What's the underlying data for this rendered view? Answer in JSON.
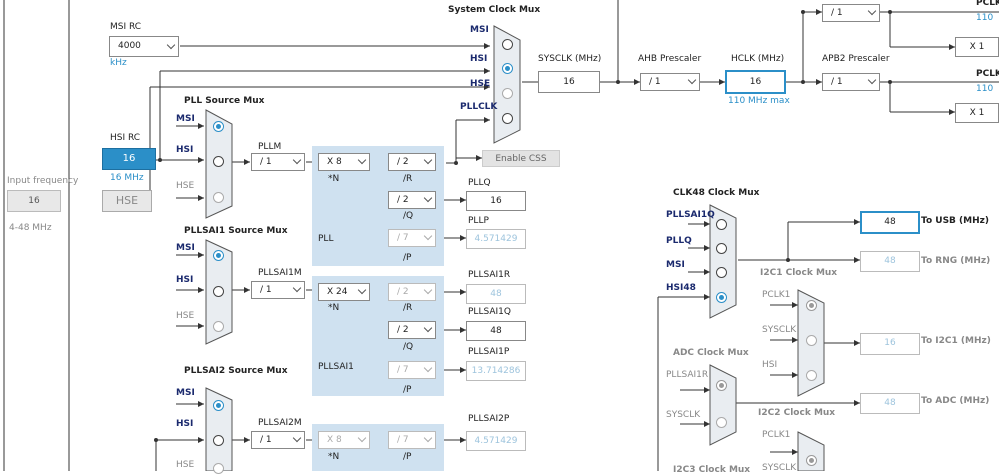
{
  "input_freq": {
    "label": "Input frequency",
    "value": "16",
    "range": "4-48 MHz"
  },
  "msi_rc": {
    "label": "MSI RC",
    "value": "4000",
    "unit": "kHz"
  },
  "hsi_rc": {
    "label": "HSI RC",
    "value": "16",
    "unit": "16 MHz"
  },
  "hse": {
    "label": "HSE"
  },
  "pll_source_mux": {
    "title": "PLL Source Mux",
    "inputs": [
      "MSI",
      "HSI",
      "HSE"
    ]
  },
  "pllm": {
    "label": "PLLM",
    "value": "/ 1"
  },
  "pll": {
    "label": "PLL",
    "n_value": "X 8",
    "n_label": "*N",
    "r_value": "/ 2",
    "r_label": "/R",
    "q_value": "/ 2",
    "q_label": "/Q",
    "p_value": "/ 7",
    "p_label": "/P"
  },
  "pllq": {
    "label": "PLLQ",
    "value": "16"
  },
  "pllp": {
    "label": "PLLP",
    "value": "4.571429"
  },
  "system_clock_mux": {
    "title": "System Clock Mux",
    "inputs": [
      "MSI",
      "HSI",
      "HSE",
      "PLLCLK"
    ]
  },
  "enable_css": "Enable CSS",
  "sysclk": {
    "label": "SYSCLK (MHz)",
    "value": "16"
  },
  "ahb": {
    "label": "AHB Prescaler",
    "value": "/ 1"
  },
  "hclk": {
    "label": "HCLK (MHz)",
    "value": "16",
    "max": "110 MHz max"
  },
  "apb1_top": {
    "value": "/ 1",
    "x1": "X 1",
    "label": "PCLK",
    "max": "110"
  },
  "apb2": {
    "label": "APB2 Prescaler",
    "value": "/ 1",
    "x1": "X 1",
    "out_label": "PCLK",
    "max": "110"
  },
  "pllsai1_source_mux": {
    "title": "PLLSAI1 Source Mux",
    "inputs": [
      "MSI",
      "HSI",
      "HSE"
    ]
  },
  "pllsai1m": {
    "label": "PLLSAI1M",
    "value": "/ 1"
  },
  "pllsai1": {
    "label": "PLLSAI1",
    "n_value": "X 24",
    "n_label": "*N",
    "r_value": "/ 2",
    "r_label": "/R",
    "q_value": "/ 2",
    "q_label": "/Q",
    "p_value": "/ 7",
    "p_label": "/P"
  },
  "pllsai1r": {
    "label": "PLLSAI1R",
    "value": "48"
  },
  "pllsai1q": {
    "label": "PLLSAI1Q",
    "value": "48"
  },
  "pllsai1p": {
    "label": "PLLSAI1P",
    "value": "13.714286"
  },
  "pllsai2_source_mux": {
    "title": "PLLSAI2 Source Mux",
    "inputs": [
      "MSI",
      "HSI",
      "HSE"
    ]
  },
  "pllsai2m": {
    "label": "PLLSAI2M",
    "value": "/ 1"
  },
  "pllsai2": {
    "n_value": "X 8",
    "n_label": "*N",
    "p_value": "/ 7",
    "p_label": "/P"
  },
  "pllsai2p": {
    "label": "PLLSAI2P",
    "value": "4.571429"
  },
  "clk48_mux": {
    "title": "CLK48 Clock Mux",
    "inputs": [
      "PLLSAI1Q",
      "PLLQ",
      "MSI",
      "HSI48"
    ]
  },
  "usb": {
    "value": "48",
    "label": "To USB (MHz)"
  },
  "rng": {
    "value": "48",
    "label": "To RNG (MHz)"
  },
  "i2c1_mux": {
    "title": "I2C1 Clock Mux",
    "inputs": [
      "PCLK1",
      "SYSCLK",
      "HSI"
    ]
  },
  "i2c1": {
    "value": "16",
    "label": "To I2C1 (MHz)"
  },
  "adc_mux": {
    "title": "ADC Clock Mux",
    "inputs": [
      "PLLSAI1R",
      "SYSCLK"
    ]
  },
  "adc": {
    "value": "48",
    "label": "To ADC (MHz)"
  },
  "i2c2_mux": {
    "title": "I2C2 Clock Mux",
    "inputs": [
      "PCLK1",
      "SYSCLK"
    ]
  },
  "i2c3_mux": {
    "title": "I2C3 Clock Mux"
  }
}
